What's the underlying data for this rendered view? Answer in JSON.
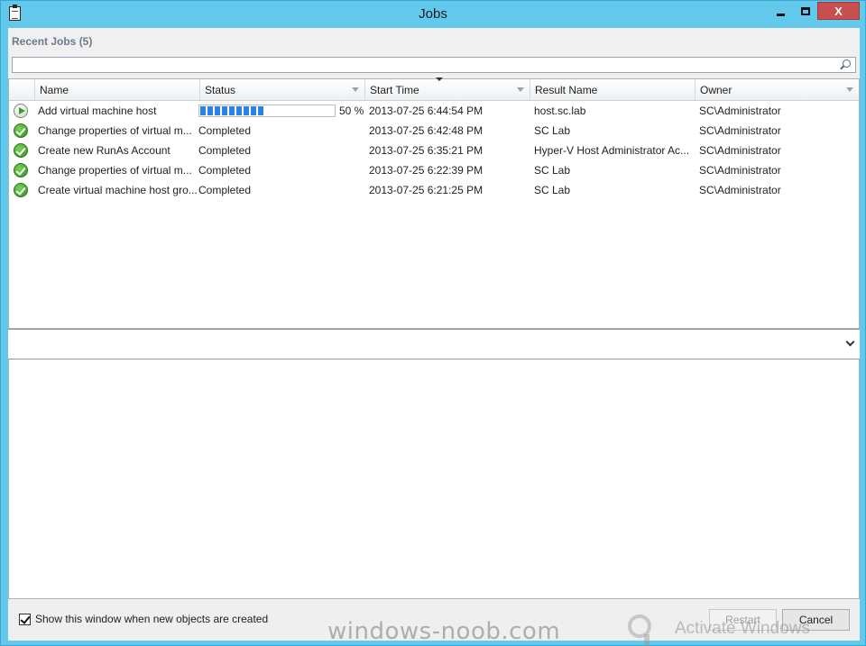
{
  "window": {
    "title": "Jobs"
  },
  "recent_jobs_label": "Recent Jobs (5)",
  "search": {
    "value": "",
    "placeholder": ""
  },
  "columns": [
    "Name",
    "Status",
    "Start Time",
    "Result Name",
    "Owner"
  ],
  "jobs": [
    {
      "state_icon": "running-icon",
      "name": "Add virtual machine host",
      "status": "",
      "progress": 50,
      "progress_text": "50 %",
      "start_time": "2013-07-25 6:44:54 PM",
      "result_name": "host.sc.lab",
      "owner": "SC\\Administrator"
    },
    {
      "state_icon": "completed-icon",
      "name": "Change properties of virtual m...",
      "status": "Completed",
      "start_time": "2013-07-25 6:42:48 PM",
      "result_name": "SC Lab",
      "owner": "SC\\Administrator"
    },
    {
      "state_icon": "completed-icon",
      "name": "Create new RunAs Account",
      "status": "Completed",
      "start_time": "2013-07-25 6:35:21 PM",
      "result_name": "Hyper-V Host Administrator Ac...",
      "owner": "SC\\Administrator"
    },
    {
      "state_icon": "completed-icon",
      "name": "Change properties of virtual m...",
      "status": "Completed",
      "start_time": "2013-07-25 6:22:39 PM",
      "result_name": "SC Lab",
      "owner": "SC\\Administrator"
    },
    {
      "state_icon": "completed-icon",
      "name": "Create virtual machine host gro...",
      "status": "Completed",
      "start_time": "2013-07-25 6:21:25 PM",
      "result_name": "SC Lab",
      "owner": "SC\\Administrator"
    }
  ],
  "footer": {
    "show_window_label": "Show this window when new objects are created",
    "show_window_checked": true,
    "restart_label": "Restart",
    "cancel_label": "Cancel"
  },
  "overlay": {
    "watermark": "windows-noob.com",
    "activate": "Activate Windows"
  }
}
